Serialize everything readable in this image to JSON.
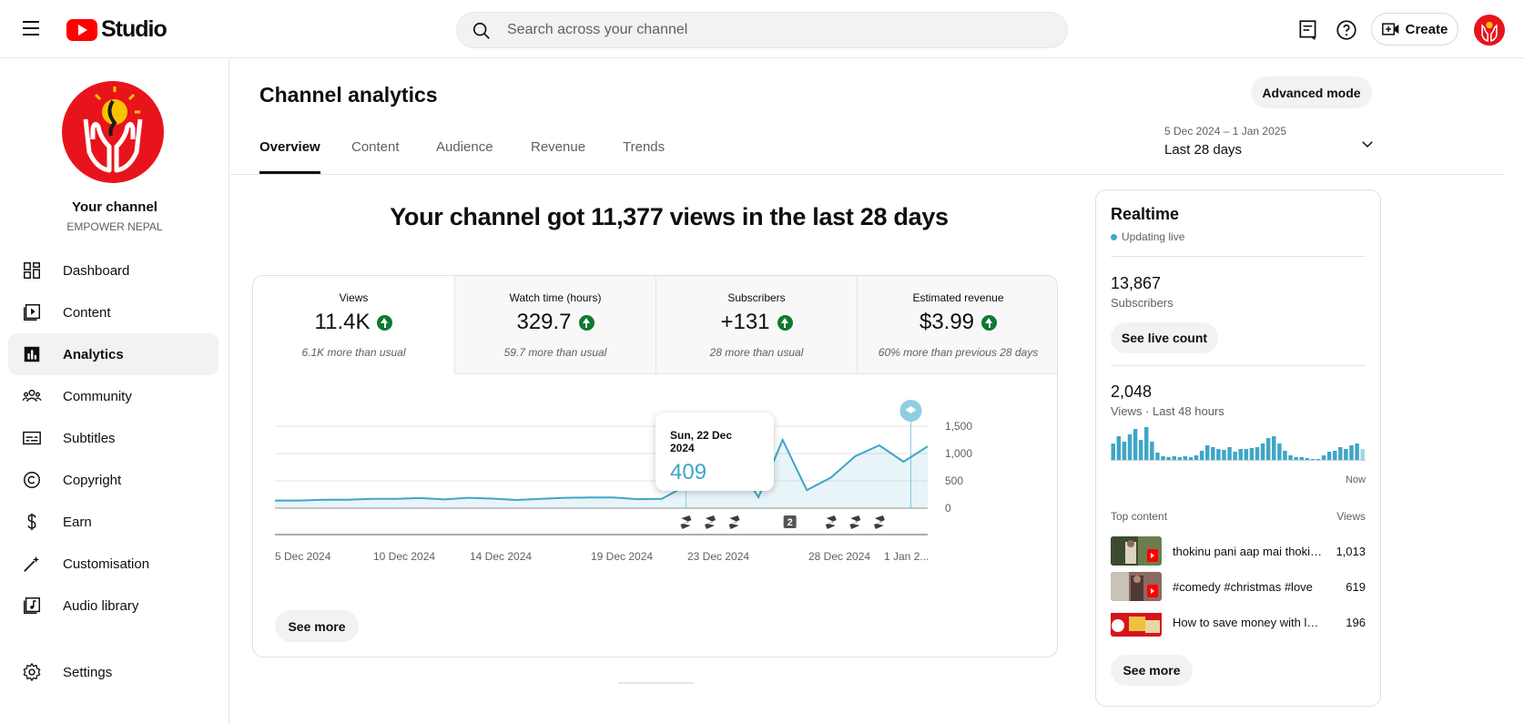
{
  "header": {
    "logo_text": "Studio",
    "search_placeholder": "Search across your channel",
    "create_label": "Create"
  },
  "sidebar": {
    "channel_title": "Your channel",
    "channel_name": "EMPOWER NEPAL",
    "items": [
      {
        "label": "Dashboard",
        "icon": "dashboard-icon"
      },
      {
        "label": "Content",
        "icon": "content-icon"
      },
      {
        "label": "Analytics",
        "icon": "analytics-icon",
        "active": true
      },
      {
        "label": "Community",
        "icon": "community-icon"
      },
      {
        "label": "Subtitles",
        "icon": "subtitles-icon"
      },
      {
        "label": "Copyright",
        "icon": "copyright-icon"
      },
      {
        "label": "Earn",
        "icon": "earn-icon"
      },
      {
        "label": "Customisation",
        "icon": "customisation-icon"
      },
      {
        "label": "Audio library",
        "icon": "audio-library-icon"
      },
      {
        "label": "Settings",
        "icon": "settings-icon"
      }
    ]
  },
  "main": {
    "title": "Channel analytics",
    "advanced_mode_label": "Advanced mode",
    "tabs": [
      "Overview",
      "Content",
      "Audience",
      "Revenue",
      "Trends"
    ],
    "date_range": {
      "dates": "5 Dec 2024 – 1 Jan 2025",
      "label": "Last 28 days"
    },
    "headline": "Your channel got 11,377 views in the last 28 days",
    "metrics": [
      {
        "label": "Views",
        "value": "11.4K",
        "note": "6.1K more than usual"
      },
      {
        "label": "Watch time (hours)",
        "value": "329.7",
        "note": "59.7 more than usual"
      },
      {
        "label": "Subscribers",
        "value": "+131",
        "note": "28 more than usual"
      },
      {
        "label": "Estimated revenue",
        "value": "$3.99",
        "note": "60% more than previous 28 days"
      }
    ],
    "tooltip": {
      "date": "Sun, 22 Dec 2024",
      "value": "409"
    },
    "see_more_label": "See more"
  },
  "chart_data": {
    "type": "area",
    "x": [
      "5 Dec",
      "6 Dec",
      "7 Dec",
      "8 Dec",
      "9 Dec",
      "10 Dec",
      "11 Dec",
      "12 Dec",
      "13 Dec",
      "14 Dec",
      "15 Dec",
      "16 Dec",
      "17 Dec",
      "18 Dec",
      "19 Dec",
      "20 Dec",
      "21 Dec",
      "22 Dec",
      "23 Dec",
      "24 Dec",
      "25 Dec",
      "26 Dec",
      "27 Dec",
      "28 Dec",
      "29 Dec",
      "30 Dec",
      "31 Dec",
      "1 Jan"
    ],
    "values": [
      140,
      140,
      155,
      155,
      170,
      170,
      185,
      160,
      190,
      175,
      150,
      170,
      190,
      195,
      195,
      165,
      170,
      409,
      520,
      900,
      200,
      1250,
      330,
      560,
      950,
      1150,
      850,
      1130
    ],
    "x_tick_labels": [
      "5 Dec 2024",
      "10 Dec 2024",
      "14 Dec 2024",
      "19 Dec 2024",
      "23 Dec 2024",
      "28 Dec 2024",
      "1 Jan 2..."
    ],
    "y_tick_labels": [
      "1,500",
      "1,000",
      "500",
      "0"
    ],
    "ylim": [
      0,
      1500
    ],
    "grid": true,
    "color": "#3ea6c8",
    "highlight_index": 17
  },
  "realtime": {
    "title": "Realtime",
    "status": "Updating live",
    "subscribers_value": "13,867",
    "subscribers_label": "Subscribers",
    "see_live_count_label": "See live count",
    "views_value": "2,048",
    "views_label": "Views · Last 48 hours",
    "now_label": "Now",
    "bars": [
      18,
      26,
      20,
      28,
      34,
      22,
      36,
      20,
      8,
      4,
      3,
      4,
      3,
      4,
      3,
      5,
      10,
      16,
      14,
      12,
      11,
      14,
      9,
      12,
      12,
      13,
      14,
      18,
      24,
      26,
      18,
      10,
      5,
      3,
      3,
      2,
      1,
      1,
      5,
      9,
      10,
      14,
      12,
      16,
      18,
      12
    ],
    "top_content_label": "Top content",
    "views_col_label": "Views",
    "top_content": [
      {
        "title": "thokinu pani aap mai thokinu",
        "views": "1,013"
      },
      {
        "title": "#comedy #christmas #love",
        "views": "619"
      },
      {
        "title": "How to save money with low income",
        "views": "196"
      }
    ],
    "see_more_label": "See more"
  }
}
